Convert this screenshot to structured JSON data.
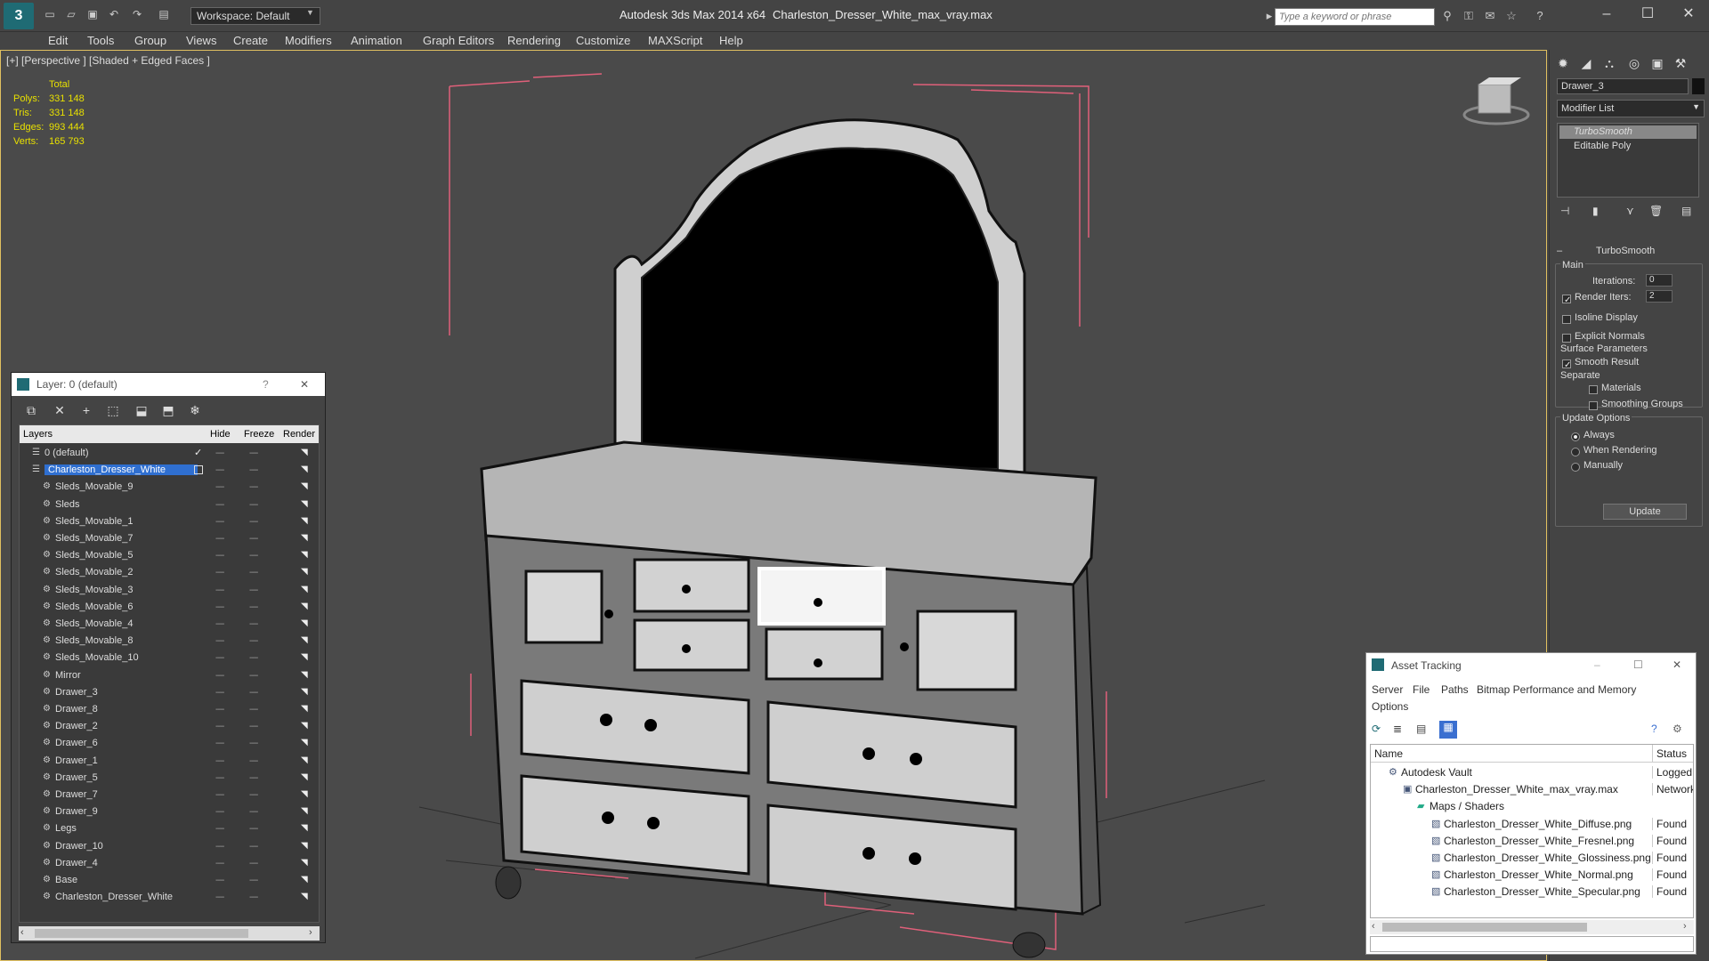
{
  "titlebar": {
    "workspace": "Workspace: Default",
    "app_title": "Autodesk 3ds Max  2014 x64",
    "file_title": "Charleston_Dresser_White_max_vray.max",
    "search_placeholder": "Type a keyword or phrase"
  },
  "menu": [
    "Edit",
    "Tools",
    "Group",
    "Views",
    "Create",
    "Modifiers",
    "Animation",
    "Graph Editors",
    "Rendering",
    "Customize",
    "MAXScript",
    "Help"
  ],
  "viewport": {
    "label": "[+] [Perspective ] [Shaded + Edged Faces ]",
    "stats_header": "Total",
    "stats": [
      {
        "label": "Polys:",
        "value": "331 148"
      },
      {
        "label": "Tris:",
        "value": "331 148"
      },
      {
        "label": "Edges:",
        "value": "993 444"
      },
      {
        "label": "Verts:",
        "value": "165 793"
      }
    ]
  },
  "command_panel": {
    "object_name": "Drawer_3",
    "modifier_list": "Modifier List",
    "stack": [
      "TurboSmooth",
      "Editable Poly"
    ],
    "rollout_title": "TurboSmooth",
    "main_label": "Main",
    "iterations_label": "Iterations:",
    "iterations_value": "0",
    "render_iters_label": "Render Iters:",
    "render_iters_value": "2",
    "isoline_label": "Isoline Display",
    "explicit_label": "Explicit Normals",
    "surface_label": "Surface Parameters",
    "smooth_label": "Smooth Result",
    "separate_label": "Separate",
    "materials_label": "Materials",
    "smoothing_groups_label": "Smoothing Groups",
    "update_options_label": "Update Options",
    "always_label": "Always",
    "when_rendering_label": "When Rendering",
    "manually_label": "Manually",
    "update_button": "Update"
  },
  "layer_window": {
    "title": "Layer: 0 (default)",
    "help": "?",
    "close": "✕",
    "columns": {
      "layers": "Layers",
      "hide": "Hide",
      "freeze": "Freeze",
      "render": "Render"
    },
    "rows": [
      {
        "name": "0 (default)",
        "level": 1
      },
      {
        "name": "Charleston_Dresser_White",
        "level": 1,
        "selected": true
      },
      {
        "name": "Sleds_Movable_9",
        "level": 2
      },
      {
        "name": "Sleds",
        "level": 2
      },
      {
        "name": "Sleds_Movable_1",
        "level": 2
      },
      {
        "name": "Sleds_Movable_7",
        "level": 2
      },
      {
        "name": "Sleds_Movable_5",
        "level": 2
      },
      {
        "name": "Sleds_Movable_2",
        "level": 2
      },
      {
        "name": "Sleds_Movable_3",
        "level": 2
      },
      {
        "name": "Sleds_Movable_6",
        "level": 2
      },
      {
        "name": "Sleds_Movable_4",
        "level": 2
      },
      {
        "name": "Sleds_Movable_8",
        "level": 2
      },
      {
        "name": "Sleds_Movable_10",
        "level": 2
      },
      {
        "name": "Mirror",
        "level": 2
      },
      {
        "name": "Drawer_3",
        "level": 2
      },
      {
        "name": "Drawer_8",
        "level": 2
      },
      {
        "name": "Drawer_2",
        "level": 2
      },
      {
        "name": "Drawer_6",
        "level": 2
      },
      {
        "name": "Drawer_1",
        "level": 2
      },
      {
        "name": "Drawer_5",
        "level": 2
      },
      {
        "name": "Drawer_7",
        "level": 2
      },
      {
        "name": "Drawer_9",
        "level": 2
      },
      {
        "name": "Legs",
        "level": 2
      },
      {
        "name": "Drawer_10",
        "level": 2
      },
      {
        "name": "Drawer_4",
        "level": 2
      },
      {
        "name": "Base",
        "level": 2
      },
      {
        "name": "Charleston_Dresser_White",
        "level": 2
      }
    ]
  },
  "asset_window": {
    "title": "Asset Tracking",
    "menu": [
      "Server",
      "File",
      "Paths",
      "Bitmap Performance and Memory",
      "Options"
    ],
    "columns": {
      "name": "Name",
      "status": "Status"
    },
    "rows": [
      {
        "name": "Autodesk Vault",
        "status": "Logged O",
        "indent": 1
      },
      {
        "name": "Charleston_Dresser_White_max_vray.max",
        "status": "Network I",
        "indent": 2
      },
      {
        "name": "Maps / Shaders",
        "status": "",
        "indent": 3
      },
      {
        "name": "Charleston_Dresser_White_Diffuse.png",
        "status": "Found",
        "indent": 4
      },
      {
        "name": "Charleston_Dresser_White_Fresnel.png",
        "status": "Found",
        "indent": 4
      },
      {
        "name": "Charleston_Dresser_White_Glossiness.png",
        "status": "Found",
        "indent": 4
      },
      {
        "name": "Charleston_Dresser_White_Normal.png",
        "status": "Found",
        "indent": 4
      },
      {
        "name": "Charleston_Dresser_White_Specular.png",
        "status": "Found",
        "indent": 4
      }
    ]
  },
  "colors": {
    "accent": "#1f6b74",
    "selection": "#2f6fd0",
    "stats": "#e8e000",
    "gizmo": "#e0607a"
  }
}
